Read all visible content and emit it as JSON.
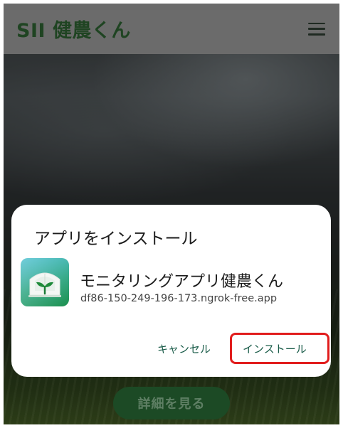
{
  "appbar": {
    "title": "SII 健農くん",
    "menu_icon": "hamburger-menu-icon"
  },
  "hero": {
    "button_label": "詳細を見る"
  },
  "install_dialog": {
    "title": "アプリをインストール",
    "app_name": "モニタリングアプリ健農くん",
    "app_url": "df86-150-249-196-173.ngrok-free.app",
    "app_icon": "greenhouse-sprout-icon",
    "cancel_label": "キャンセル",
    "install_label": "インストール",
    "highlight_color": "#e11d1d"
  },
  "colors": {
    "accent": "#1a5c49",
    "brand_dark": "#1f4422"
  }
}
